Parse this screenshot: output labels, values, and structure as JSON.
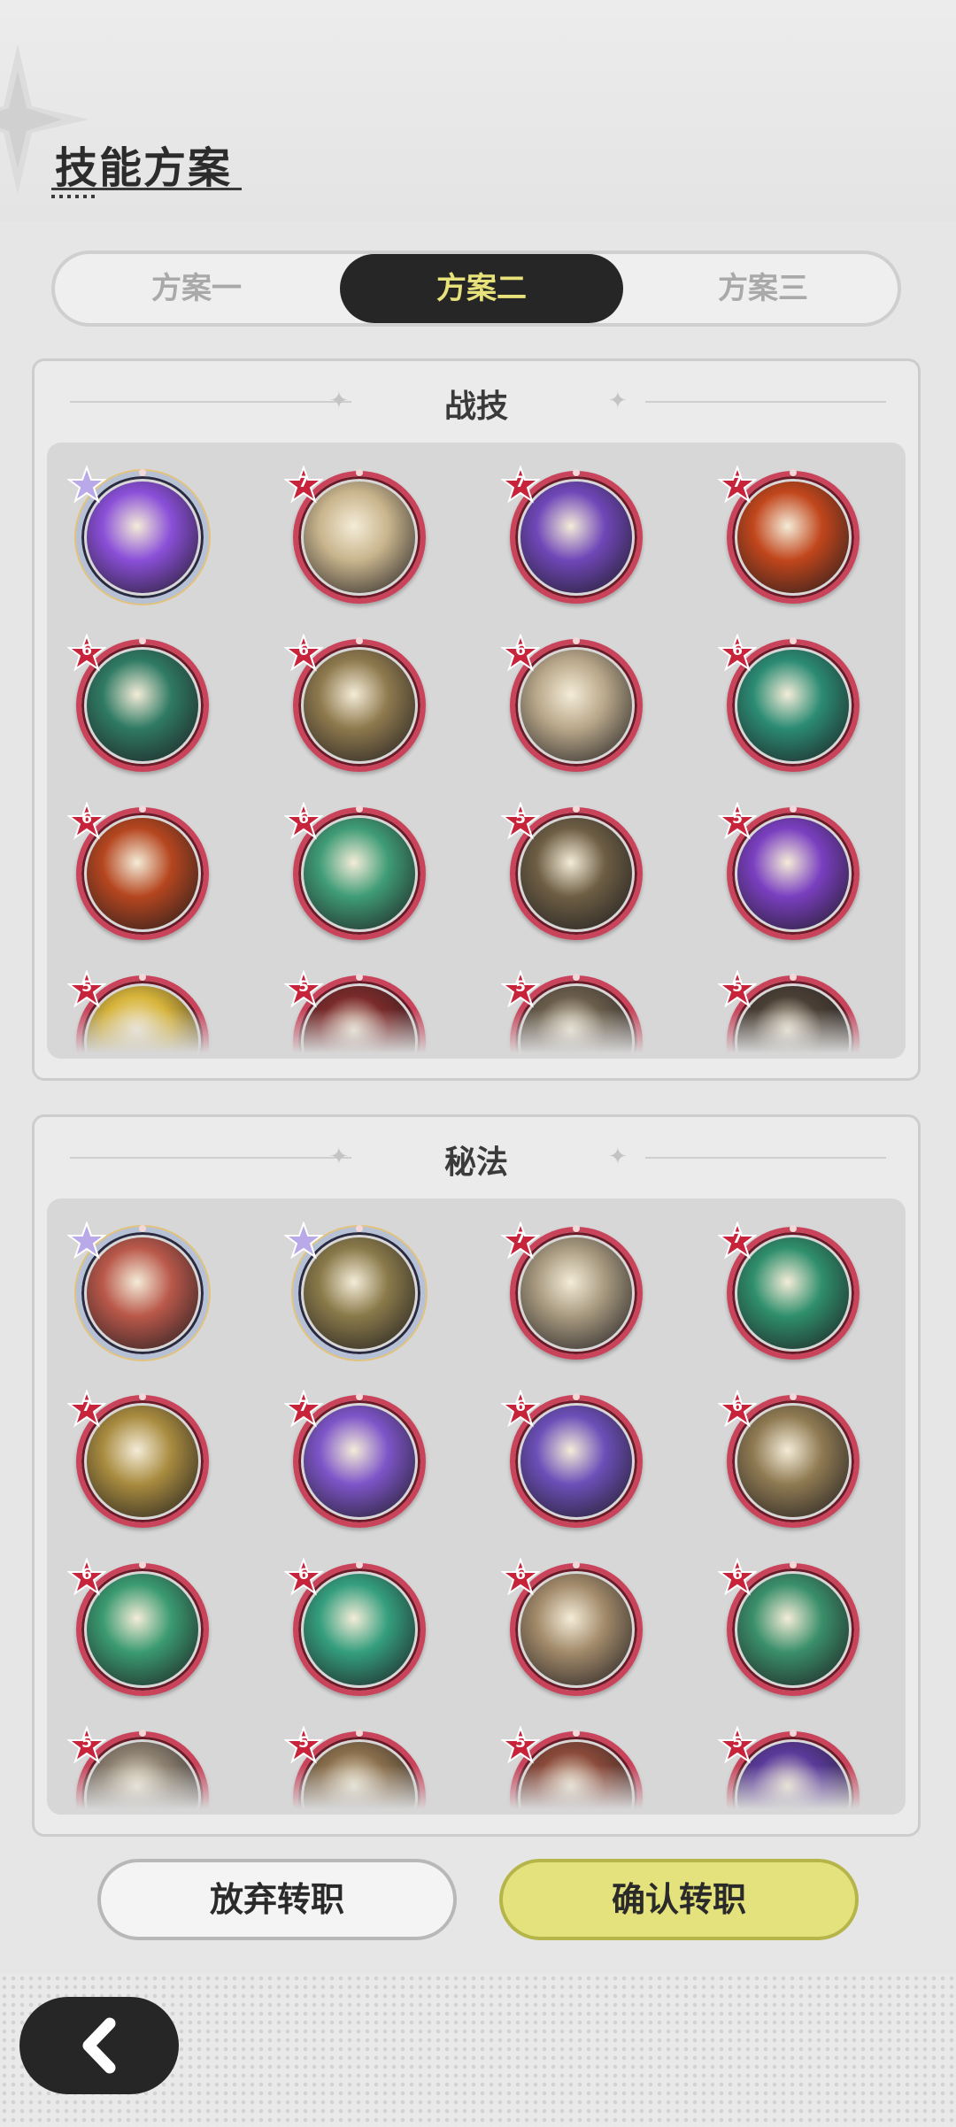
{
  "header": {
    "title": "技能方案"
  },
  "tabs": [
    {
      "label": "方案一",
      "active": false
    },
    {
      "label": "方案二",
      "active": true
    },
    {
      "label": "方案三",
      "active": false
    }
  ],
  "sections": [
    {
      "title": "战技",
      "skills": [
        {
          "level": "",
          "color": "#8a4fd8",
          "star": true
        },
        {
          "level": "7",
          "color": "#c9b58d",
          "star": false
        },
        {
          "level": "7",
          "color": "#6f47b8",
          "star": false
        },
        {
          "level": "7",
          "color": "#c1461c",
          "star": false
        },
        {
          "level": "6",
          "color": "#2f7a63",
          "star": false
        },
        {
          "level": "6",
          "color": "#8f7a4e",
          "star": false
        },
        {
          "level": "6",
          "color": "#b9a88a",
          "star": false
        },
        {
          "level": "6",
          "color": "#2b8b73",
          "star": false
        },
        {
          "level": "6",
          "color": "#b5461f",
          "star": false
        },
        {
          "level": "6",
          "color": "#3f9c76",
          "star": false
        },
        {
          "level": "5",
          "color": "#6d5e44",
          "star": false
        },
        {
          "level": "5",
          "color": "#7a3fc0",
          "star": false
        },
        {
          "level": "5",
          "color": "#d7b43a",
          "star": false
        },
        {
          "level": "5",
          "color": "#7a2a2a",
          "star": false
        },
        {
          "level": "5",
          "color": "#6a5d4b",
          "star": false
        },
        {
          "level": "5",
          "color": "#4a3f35",
          "star": false
        }
      ]
    },
    {
      "title": "秘法",
      "skills": [
        {
          "level": "",
          "color": "#b9584a",
          "star": true
        },
        {
          "level": "",
          "color": "#8a7a4a",
          "star": true
        },
        {
          "level": "7",
          "color": "#a89a80",
          "star": false
        },
        {
          "level": "7",
          "color": "#2f8f6c",
          "star": false
        },
        {
          "level": "7",
          "color": "#a88b3f",
          "star": false
        },
        {
          "level": "7",
          "color": "#7d55c8",
          "star": false
        },
        {
          "level": "6",
          "color": "#6c4fb8",
          "star": false
        },
        {
          "level": "6",
          "color": "#8f7a52",
          "star": false
        },
        {
          "level": "6",
          "color": "#3a9a70",
          "star": false
        },
        {
          "level": "6",
          "color": "#349e7d",
          "star": false
        },
        {
          "level": "6",
          "color": "#a28a6a",
          "star": false
        },
        {
          "level": "6",
          "color": "#3a8f6a",
          "star": false
        },
        {
          "level": "5",
          "color": "#8c8070",
          "star": false
        },
        {
          "level": "5",
          "color": "#8a6f4c",
          "star": false
        },
        {
          "level": "5",
          "color": "#8a4a3a",
          "star": false
        },
        {
          "level": "5",
          "color": "#5a3a9a",
          "star": false
        }
      ]
    }
  ],
  "buttons": {
    "cancel": "放弃转职",
    "confirm": "确认转职"
  },
  "icons": {
    "back": "chevron-left-icon"
  }
}
